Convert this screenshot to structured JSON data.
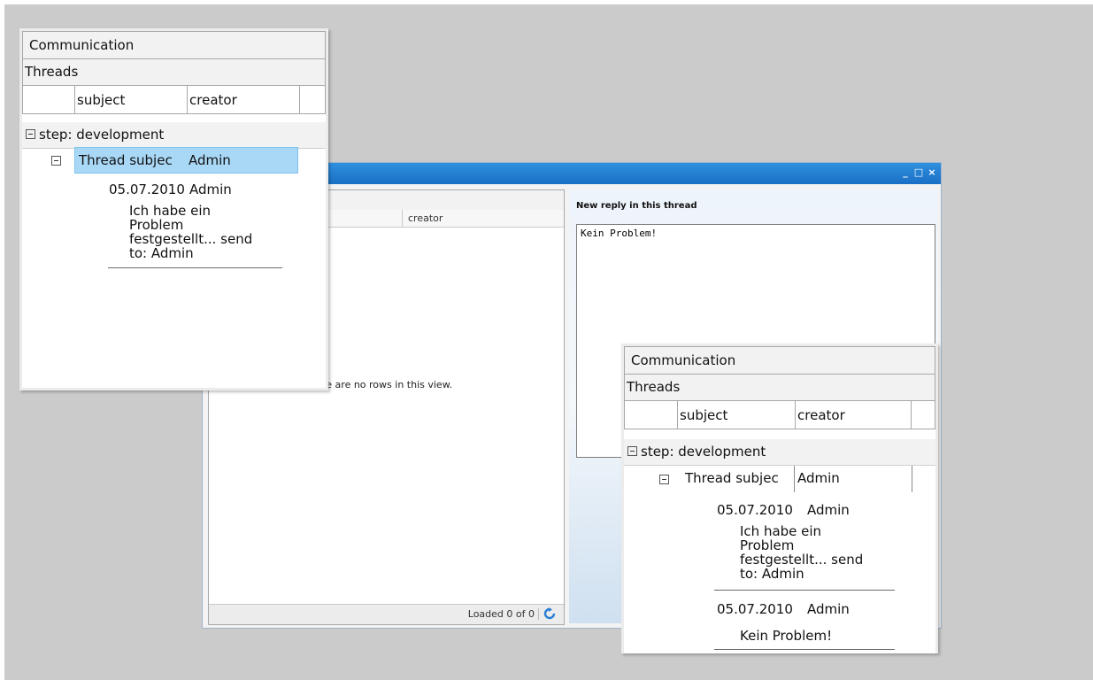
{
  "main_window": {
    "controls": {
      "minimize": "_",
      "maximize": "□",
      "close": "×"
    },
    "grid": {
      "column_creator": "creator",
      "empty_text": "re are no rows in this view.",
      "loaded": "Loaded 0 of 0"
    },
    "reply": {
      "label": "New reply in this thread",
      "text": "Kein Problem!"
    }
  },
  "panel_left": {
    "title": "Communication",
    "section": "Threads",
    "columns": {
      "subject": "subject",
      "creator": "creator"
    },
    "step": "step: development",
    "thread": {
      "subject": "Thread subjec",
      "creator": "Admin"
    },
    "messages": [
      {
        "date": "05.07.2010",
        "author": "Admin",
        "lines": [
          "Ich habe ein",
          "Problem",
          "festgestellt... send",
          "to: Admin"
        ]
      }
    ]
  },
  "panel_right": {
    "title": "Communication",
    "section": "Threads",
    "columns": {
      "subject": "subject",
      "creator": "creator"
    },
    "step": "step: development",
    "thread": {
      "subject": "Thread subjec",
      "creator": "Admin"
    },
    "messages": [
      {
        "date": "05.07.2010",
        "author": "Admin",
        "lines": [
          "Ich habe ein",
          "Problem",
          "festgestellt... send",
          "to: Admin"
        ]
      },
      {
        "date": "05.07.2010",
        "author": "Admin",
        "lines": [
          "Kein Problem!"
        ]
      }
    ]
  },
  "colors": {
    "background": "#cbcbcb",
    "titlebar": "#1f7ad0",
    "selected_row": "#a9d8f7"
  }
}
